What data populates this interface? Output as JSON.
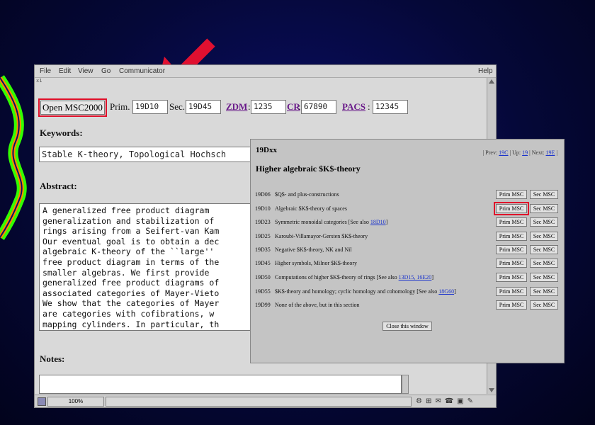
{
  "menubar": {
    "items": [
      "File",
      "Edit",
      "View",
      "Go",
      "Communicator"
    ],
    "help": "Help"
  },
  "window_corner": "x1",
  "form": {
    "open_button": "Open MSC2000",
    "prim_label": "Prim.",
    "prim_value": "19D10",
    "sec_label": "Sec.",
    "sec_value": "19D45",
    "zdm_link": "ZDM",
    "zdm_value": "1235",
    "cr_link": "CR",
    "cr_value": "67890",
    "pacs_link": "PACS",
    "pacs_value": "12345",
    "colon": ":",
    "keywords_label": "Keywords:",
    "keywords_value": "Stable K-theory, Topological Hochsch",
    "abstract_label": "Abstract:",
    "abstract_value": "A generalized free product diagram \ngeneralization and stabilization of\nrings arising from a Seifert-van Kam\nOur eventual goal is to obtain a dec\nalgebraic K-theory of the ``large''\nfree product diagram in terms of the\nsmaller algebras. We first provide \ngeneralized free product diagrams of\nassociated categories of Mayer-Vieto\nWe show that the categories of Mayer\nare categories with cofibrations, w\nmapping cylinders. In particular, th",
    "notes_label": "Notes:"
  },
  "statusbar": {
    "zoom": "100%"
  },
  "popup": {
    "code": "19Dxx",
    "nav": {
      "prev_label": "| Prev:",
      "prev": "19C",
      "up_label": "| Up:",
      "up": "19",
      "next_label": "| Next:",
      "next": "19E",
      "end": "|"
    },
    "title": "Higher algebraic $K$-theory",
    "prim_btn": "Prim MSC",
    "sec_btn": "Sec MSC",
    "rows": [
      {
        "code": "19D06",
        "desc": "$Q$- and plus-constructions",
        "ref": ""
      },
      {
        "code": "19D10",
        "desc": "Algebraic $K$-theory of spaces",
        "ref": ""
      },
      {
        "code": "19D23",
        "desc": "Symmetric monoidal categories [See also ",
        "ref": "18D10",
        "tail": "]"
      },
      {
        "code": "19D25",
        "desc": "Karoubi-Villamayor-Gersten $K$-theory",
        "ref": ""
      },
      {
        "code": "19D35",
        "desc": "Negative $K$-theory, NK and Nil",
        "ref": ""
      },
      {
        "code": "19D45",
        "desc": "Higher symbols, Milnor $K$-theory",
        "ref": ""
      },
      {
        "code": "19D50",
        "desc": "Computations of higher $K$-theory of rings [See also ",
        "ref": "13D15, 16E20",
        "tail": "]"
      },
      {
        "code": "19D55",
        "desc": "$K$-theory and homology; cyclic homology and cohomology [See also ",
        "ref": "18G60",
        "tail": "]"
      },
      {
        "code": "19D99",
        "desc": "None of the above, but in this section",
        "ref": ""
      }
    ],
    "close_button": "Close this window"
  }
}
